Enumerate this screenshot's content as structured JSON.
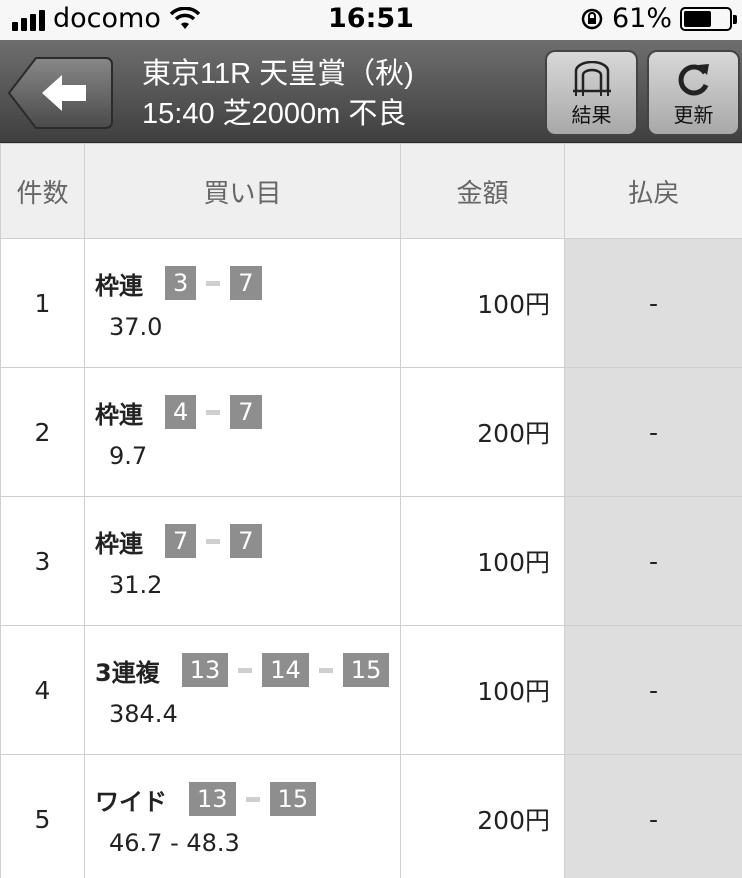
{
  "status_bar": {
    "carrier": "docomo",
    "time": "16:51",
    "battery": "61%",
    "battery_level": 0.61
  },
  "header": {
    "title_line1": "東京11R 天皇賞（秋)",
    "title_line2": "15:40 芝2000m 不良",
    "result_label": "結果",
    "refresh_label": "更新"
  },
  "table": {
    "columns": [
      "件数",
      "買い目",
      "金額",
      "払戻"
    ],
    "rows": [
      {
        "count": "1",
        "type": "枠連",
        "numbers": [
          "3",
          "7"
        ],
        "odds": "37.0",
        "amount": "100円",
        "payout": "-"
      },
      {
        "count": "2",
        "type": "枠連",
        "numbers": [
          "4",
          "7"
        ],
        "odds": "9.7",
        "amount": "200円",
        "payout": "-"
      },
      {
        "count": "3",
        "type": "枠連",
        "numbers": [
          "7",
          "7"
        ],
        "odds": "31.2",
        "amount": "100円",
        "payout": "-"
      },
      {
        "count": "4",
        "type": "3連複",
        "numbers": [
          "13",
          "14",
          "15"
        ],
        "odds": "384.4",
        "amount": "100円",
        "payout": "-"
      },
      {
        "count": "5",
        "type": "ワイド",
        "numbers": [
          "13",
          "15"
        ],
        "odds": "46.7 - 48.3",
        "amount": "200円",
        "payout": "-"
      }
    ]
  }
}
